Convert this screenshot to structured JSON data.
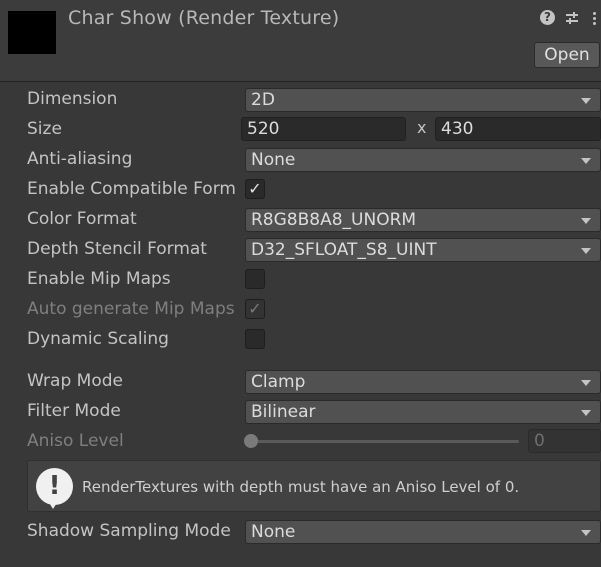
{
  "header": {
    "title": "Char Show (Render Texture)",
    "help_glyph": "?",
    "open_label": "Open"
  },
  "properties": {
    "dimension": {
      "label": "Dimension",
      "value": "2D"
    },
    "size": {
      "label": "Size",
      "width": "520",
      "separator": "x",
      "height": "430"
    },
    "anti_aliasing": {
      "label": "Anti-aliasing",
      "value": "None"
    },
    "enable_compatible_format": {
      "label": "Enable Compatible Form",
      "checked": true,
      "mark": "✓"
    },
    "color_format": {
      "label": "Color Format",
      "value": "R8G8B8A8_UNORM"
    },
    "depth_stencil_format": {
      "label": "Depth Stencil Format",
      "value": "D32_SFLOAT_S8_UINT"
    },
    "enable_mip_maps": {
      "label": "Enable Mip Maps",
      "checked": false
    },
    "auto_generate_mip_maps": {
      "label": "Auto generate Mip Maps",
      "checked": true,
      "mark": "✓"
    },
    "dynamic_scaling": {
      "label": "Dynamic Scaling",
      "checked": false
    },
    "wrap_mode": {
      "label": "Wrap Mode",
      "value": "Clamp"
    },
    "filter_mode": {
      "label": "Filter Mode",
      "value": "Bilinear"
    },
    "aniso_level": {
      "label": "Aniso Level",
      "value": "0",
      "slider_fraction": 0
    },
    "shadow_sampling_mode": {
      "label": "Shadow Sampling Mode",
      "value": "None"
    }
  },
  "help_box": {
    "icon": "warning-icon",
    "glyph": "!",
    "message": "RenderTextures with depth must have an Aniso Level of 0."
  },
  "colors": {
    "background": "#383838",
    "header": "#3c3c3c",
    "text": "#c4c4c4",
    "disabled_text": "#7f7f7f"
  }
}
